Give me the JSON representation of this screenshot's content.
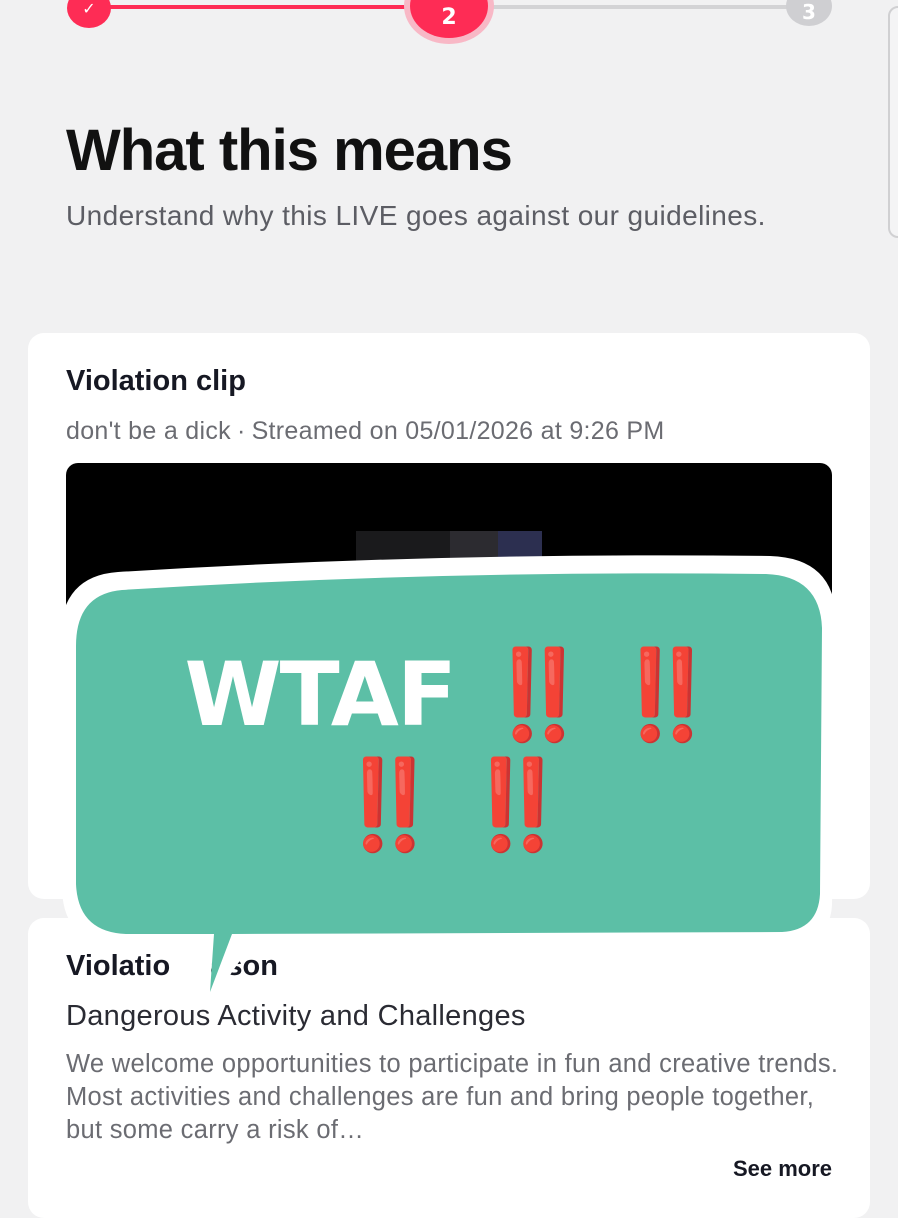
{
  "stepper": {
    "step1_icon": "✓",
    "step2_label": "2",
    "step3_label": "3"
  },
  "header": {
    "title": "What this means",
    "subtitle": "Understand why this LIVE goes against our guidelines."
  },
  "violation_clip": {
    "title": "Violation clip",
    "stream_title": "don't be a dick",
    "separator": "·",
    "streamed_on": "Streamed on 05/01/2026 at 9:26 PM"
  },
  "violation_reason": {
    "title_left": "Violatio",
    "title_right": "ason",
    "category": "Dangerous Activity and Challenges",
    "description": "We welcome opportunities to participate in fun and creative trends. Most activities and challenges are fun and bring people together, but some carry a risk of…",
    "see_more": "See more"
  },
  "overlay": {
    "text": "WTAF",
    "exclamations": "‼️ ‼️ ‼️ ‼️",
    "bubble_color": "#5cbfa6",
    "exclamation_color": "#ee1a45"
  },
  "colors": {
    "accent": "#fe2c55",
    "background": "#f1f1f2"
  }
}
